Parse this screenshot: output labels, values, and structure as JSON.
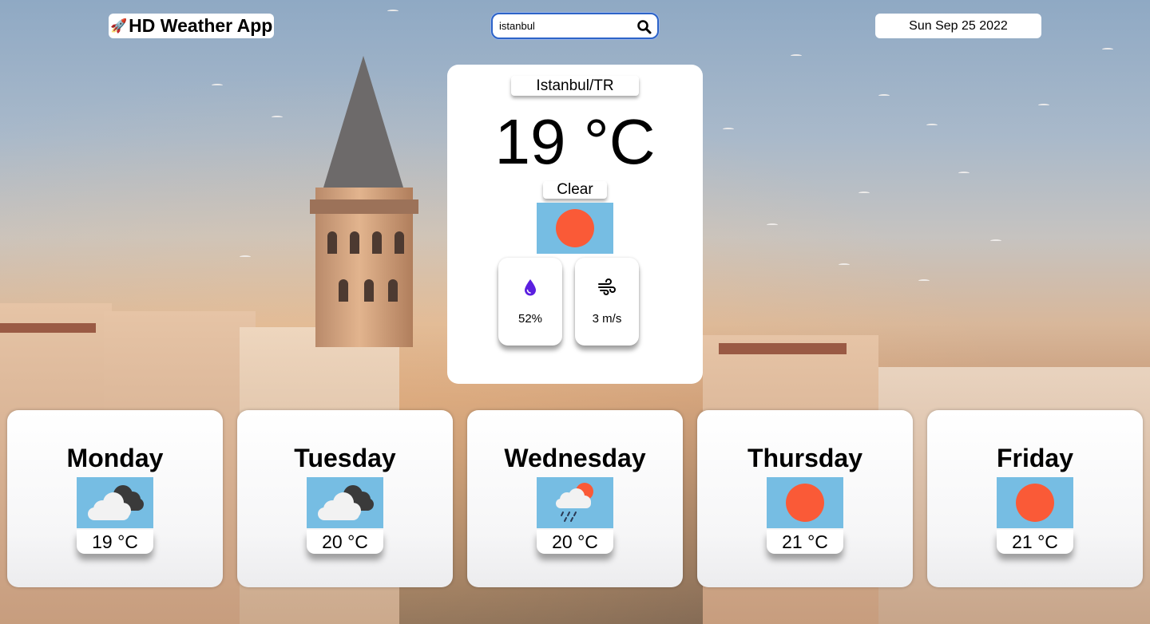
{
  "header": {
    "logo_text": "HD Weather App",
    "logo_icon": "rocket-icon",
    "search": {
      "value": "istanbul",
      "icon": "search-icon"
    },
    "date": "Sun Sep 25 2022"
  },
  "current": {
    "location": "Istanbul/TR",
    "temperature": "19 °C",
    "condition": "Clear",
    "condition_icon": "sun-icon",
    "humidity": {
      "icon": "droplet-icon",
      "value": "52%"
    },
    "wind": {
      "icon": "wind-icon",
      "value": "3 m/s"
    }
  },
  "forecast": [
    {
      "day": "Monday",
      "temp": "19 °C",
      "icon": "cloudy-icon"
    },
    {
      "day": "Tuesday",
      "temp": "20 °C",
      "icon": "cloudy-icon"
    },
    {
      "day": "Wednesday",
      "temp": "20 °C",
      "icon": "rain-sun-icon"
    },
    {
      "day": "Thursday",
      "temp": "21 °C",
      "icon": "sun-icon"
    },
    {
      "day": "Friday",
      "temp": "21 °C",
      "icon": "sun-icon"
    }
  ],
  "colors": {
    "icon_background": "#76bde3",
    "sun": "#fa5a37",
    "search_border": "#2d64c8",
    "droplet": "#5b1fe0"
  }
}
